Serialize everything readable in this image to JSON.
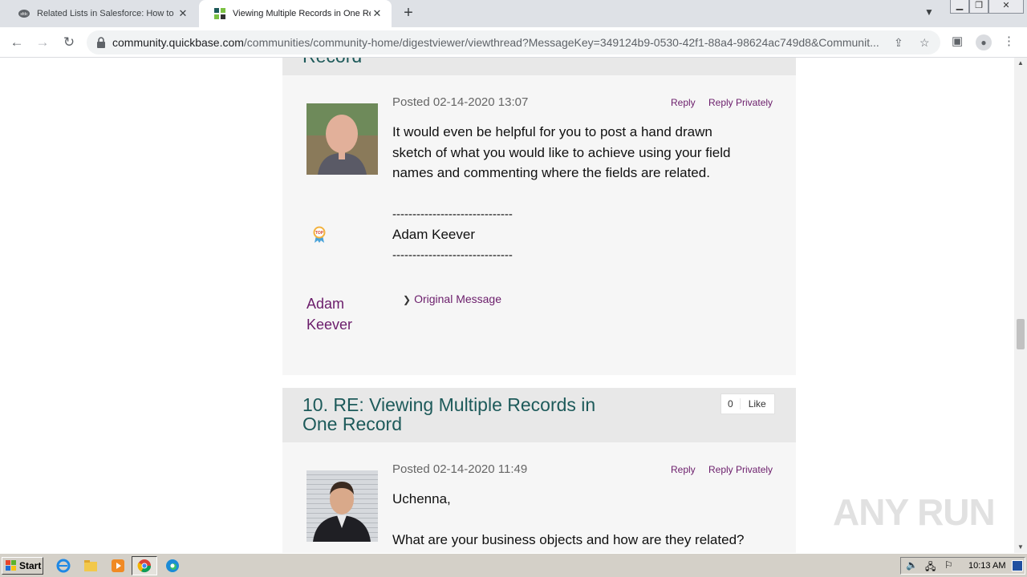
{
  "browser": {
    "tabs": [
      {
        "title": "Related Lists in Salesforce: How to S",
        "active": false
      },
      {
        "title": "Viewing Multiple Records in One Rec",
        "active": true
      }
    ],
    "url_host": "community.quickbase.com",
    "url_path": "/communities/community-home/digestviewer/viewthread?MessageKey=349124b9-0530-42f1-88a4-98624ac749d8&Communit..."
  },
  "thread": {
    "prev_header_fragment": "Record",
    "post9": {
      "posted": "Posted 02-14-2020 13:07",
      "reply_label": "Reply",
      "reply_private_label": "Reply Privately",
      "lines": [
        "It would even be helpful for you to post a hand drawn",
        "sketch of what you would like to achieve using your field",
        "names and commenting where the fields are related."
      ],
      "sig_divider_top": "------------------------------",
      "sig_name": "Adam Keever",
      "sig_divider_bottom": "------------------------------",
      "author_first": "Adam",
      "author_last": "Keever",
      "original_message": "Original Message",
      "badge_icon": "top-contributor-badge-icon"
    },
    "post10": {
      "heading_line1": "10.  RE: Viewing Multiple Records in",
      "heading_line2": "One Record",
      "like_count": "0",
      "like_label": "Like",
      "posted": "Posted 02-14-2020 11:49",
      "reply_label": "Reply",
      "reply_private_label": "Reply Privately",
      "greeting": "Uchenna,",
      "question": "What are your business objects and how are they related?"
    }
  },
  "watermark": "ANY RUN",
  "taskbar": {
    "start_label": "Start",
    "clock": "10:13 AM"
  },
  "colors": {
    "heading": "#1d5a5a",
    "link": "#6b1d6b",
    "post_head_bg": "#e8e8e8",
    "post_body_bg": "#f6f6f6"
  }
}
